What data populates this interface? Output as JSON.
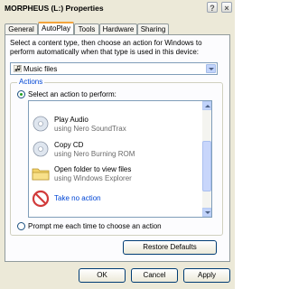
{
  "window": {
    "title": "MORPHEUS (L:) Properties",
    "help_glyph": "?",
    "close_glyph": "×"
  },
  "tabs": [
    {
      "label": "General",
      "active": false
    },
    {
      "label": "AutoPlay",
      "active": true
    },
    {
      "label": "Tools",
      "active": false
    },
    {
      "label": "Hardware",
      "active": false
    },
    {
      "label": "Sharing",
      "active": false
    }
  ],
  "content_type": {
    "description": "Select a content type, then choose an action for Windows to perform automatically when that type is used in this device:",
    "selected": "Music files",
    "icon": "music-files-icon"
  },
  "actions": {
    "legend": "Actions",
    "select_label": "Select an action to perform:",
    "prompt_label": "Prompt me each time to choose an action",
    "selected_option": "select",
    "items": [
      {
        "title": "Play Audio",
        "subtitle": "using Nero SoundTrax",
        "icon": "play-audio-icon",
        "selected": false
      },
      {
        "title": "Copy CD",
        "subtitle": "using Nero Burning ROM",
        "icon": "copy-cd-icon",
        "selected": false
      },
      {
        "title": "Open folder to view files",
        "subtitle": "using Windows Explorer",
        "icon": "folder-icon",
        "selected": false
      },
      {
        "title": "Take no action",
        "subtitle": "",
        "icon": "no-action-icon",
        "selected": true
      }
    ]
  },
  "buttons": {
    "restore": "Restore Defaults",
    "ok": "OK",
    "cancel": "Cancel",
    "apply": "Apply"
  },
  "colors": {
    "tab_highlight": "#f3a43c",
    "selected_text": "#0046d5",
    "dialog_bg": "#ece9d8"
  }
}
